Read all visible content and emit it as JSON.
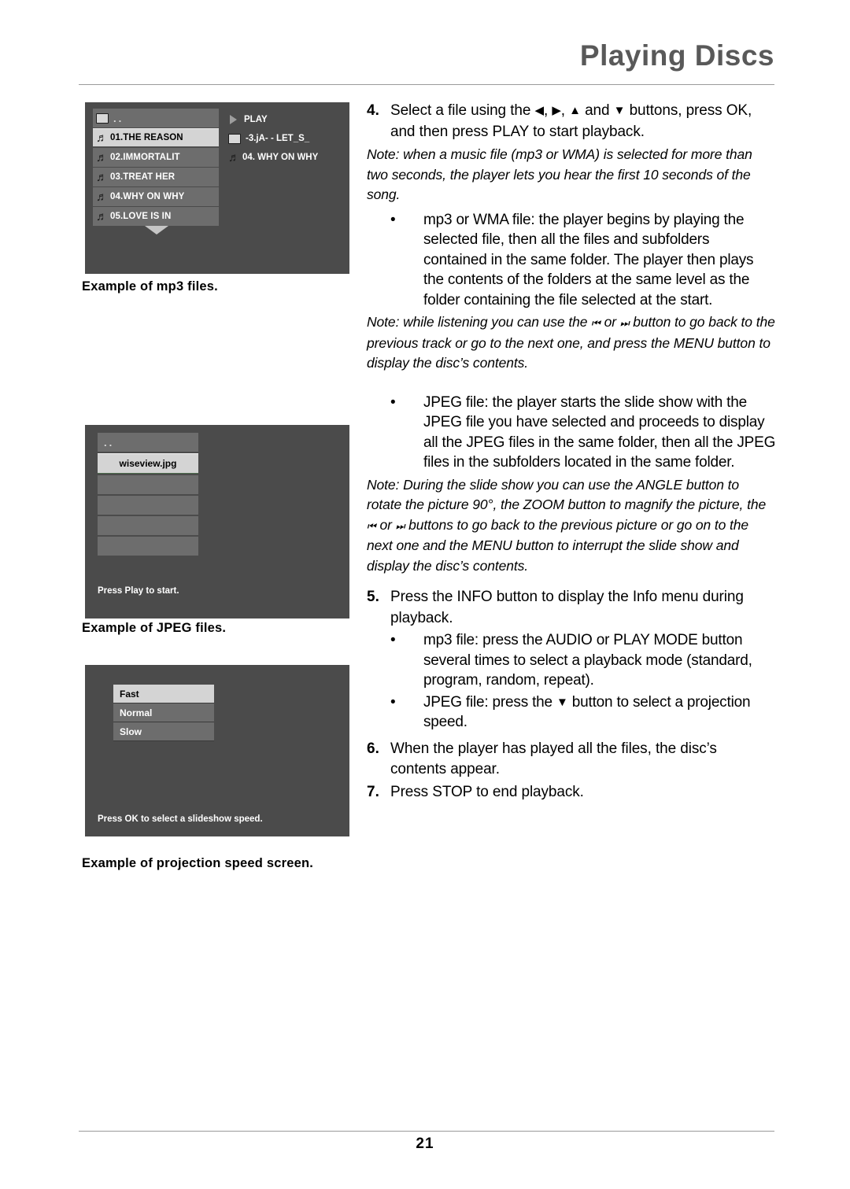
{
  "header": {
    "title": "Playing Discs"
  },
  "footer": {
    "page_number": "21"
  },
  "screens": {
    "mp3": {
      "caption": "Example of mp3 files.",
      "left_items": [
        {
          "label": "..",
          "icon": "folder-icon",
          "selected": false
        },
        {
          "label": "01.THE REASON",
          "icon": "music-note-icon",
          "selected": true
        },
        {
          "label": "02.IMMORTALIT",
          "icon": "music-note-icon",
          "selected": false
        },
        {
          "label": "03.TREAT HER",
          "icon": "music-note-icon",
          "selected": false
        },
        {
          "label": "04.WHY ON WHY",
          "icon": "music-note-icon",
          "selected": false
        },
        {
          "label": "05.LOVE IS IN",
          "icon": "music-note-icon",
          "selected": false
        }
      ],
      "right_items": [
        {
          "label": "PLAY",
          "icon": "play-triangle-icon"
        },
        {
          "label": "-3.jA- - LET_S_",
          "icon": "folder-icon"
        },
        {
          "label": "04. WHY ON WHY",
          "icon": "music-note-icon"
        }
      ]
    },
    "jpeg": {
      "caption": "Example of JPEG files.",
      "items": [
        {
          "label": "..",
          "selected": false
        },
        {
          "label": "wiseview.jpg",
          "selected": true
        },
        {
          "label": "",
          "selected": false
        },
        {
          "label": "",
          "selected": false
        },
        {
          "label": "",
          "selected": false
        },
        {
          "label": "",
          "selected": false
        }
      ],
      "hint": "Press Play to start."
    },
    "speed": {
      "caption": "Example of projection speed screen.",
      "items": [
        {
          "label": "Fast",
          "selected": true
        },
        {
          "label": "Normal",
          "selected": false
        },
        {
          "label": "Slow",
          "selected": false
        }
      ],
      "hint": "Press OK to select a slideshow speed."
    }
  },
  "body": {
    "step4": {
      "num": "4.",
      "text_a": "Select a file using the",
      "text_b": ",",
      "text_c": ",",
      "text_d": "and",
      "text_e": "buttons, press OK, and then press PLAY to start playback."
    },
    "note1": "Note: when a music file (mp3 or WMA) is selected for more than two seconds, the player lets you hear the first 10 seconds of the song.",
    "bullet_mp3": "mp3 or WMA file: the player begins by playing the selected file, then all the files and subfolders contained in the same folder. The player then plays the contents of the folders at the same level as the folder containing the file selected at the start.",
    "note2_a": "Note: while listening you can use the",
    "note2_b": "or",
    "note2_c": "button to go back to the previous track or go to the next one, and press the MENU button to display the disc’s contents.",
    "bullet_jpeg": "JPEG file: the player starts the slide show with the JPEG file you have selected and proceeds to display all the JPEG files in the same folder, then all the JPEG files in the subfolders located in the same folder.",
    "note3_a": "Note: During the slide show you can use the ANGLE button to rotate the picture 90°, the ZOOM button to magnify the picture, the",
    "note3_b": "or",
    "note3_c": "buttons to go back to the previous picture or go on to the next one and the MENU button to interrupt the slide show and display the disc’s contents.",
    "step5": {
      "num": "5.",
      "text": "Press the INFO button to display the Info menu during playback."
    },
    "bullet_audio": "mp3 file: press the AUDIO or PLAY MODE button several times to select a playback mode (standard, program, random, repeat).",
    "bullet_proj_a": "JPEG file: press the",
    "bullet_proj_b": "button to select a projection speed.",
    "step6": {
      "num": "6.",
      "text": "When the player has played all the files, the disc’s contents appear."
    },
    "step7": {
      "num": "7.",
      "text": "Press STOP to end playback."
    },
    "glyphs": {
      "left": "◀",
      "right": "▶",
      "up": "▲",
      "down": "▼",
      "prev": "⏮",
      "next": "⏭",
      "bullet": "•"
    }
  }
}
